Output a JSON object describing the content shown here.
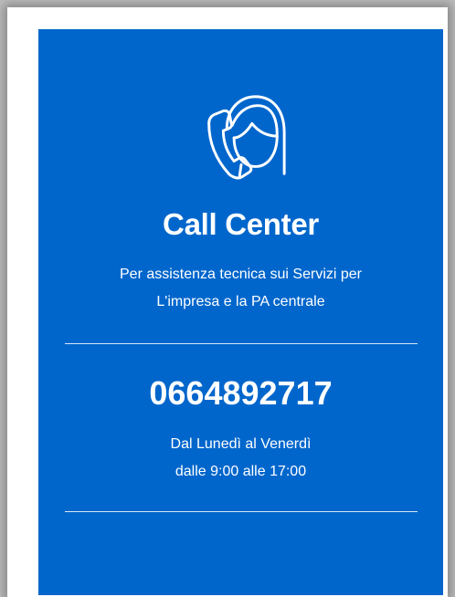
{
  "card": {
    "background_color": "#0066cc",
    "icon": "call-center-headset-icon",
    "title": "Call Center",
    "description_line1": "Per assistenza tecnica sui Servizi per",
    "description_line2": "L'impresa e la PA centrale",
    "phone_number": "0664892717",
    "hours_line1": "Dal Lunedì al Venerdì",
    "hours_line2": "dalle 9:00 alle 17:00"
  }
}
